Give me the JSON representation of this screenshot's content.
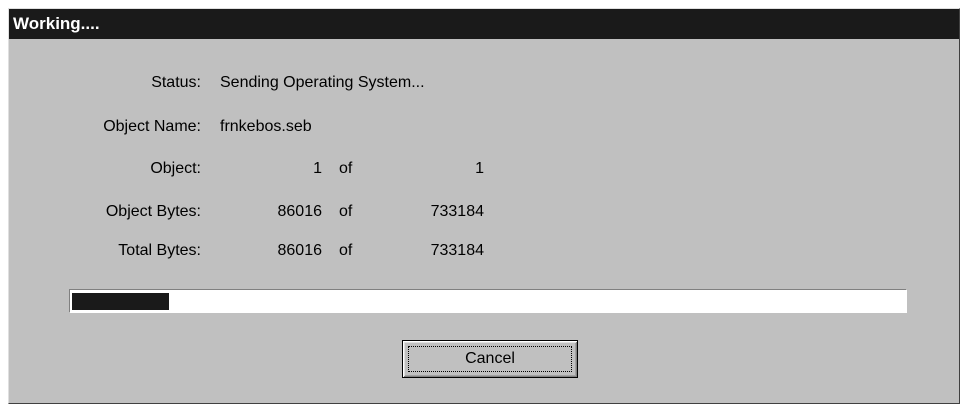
{
  "window": {
    "title": "Working...."
  },
  "rows": {
    "status": {
      "label": "Status:",
      "value": "Sending Operating System..."
    },
    "object_name": {
      "label": "Object Name:",
      "value": "frnkebos.seb"
    },
    "object": {
      "label": "Object:",
      "current": "1",
      "of": "of",
      "total": "1"
    },
    "object_bytes": {
      "label": "Object Bytes:",
      "current": "86016",
      "of": "of",
      "total": "733184"
    },
    "total_bytes": {
      "label": "Total Bytes:",
      "current": "86016",
      "of": "of",
      "total": "733184"
    }
  },
  "progress": {
    "fraction": 0.117
  },
  "buttons": {
    "cancel": "Cancel"
  },
  "colors": {
    "dialog": "#c0c0c0",
    "titlebar": "#1a1a1a",
    "progress_fill": "#1a1a1a"
  }
}
